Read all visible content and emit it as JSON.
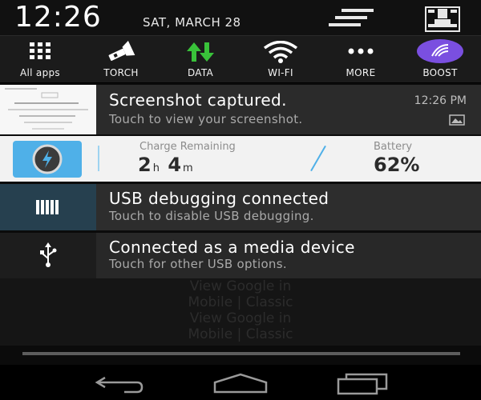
{
  "status_bar": {
    "time": "12:26",
    "date": "SAT, MARCH 28"
  },
  "quick_settings": [
    {
      "label": "All apps",
      "icon": "grid-icon"
    },
    {
      "label": "TORCH",
      "icon": "flashlight-icon"
    },
    {
      "label": "DATA",
      "icon": "data-arrows-icon"
    },
    {
      "label": "WI-FI",
      "icon": "wifi-icon"
    },
    {
      "label": "MORE",
      "icon": "more-dots-icon"
    },
    {
      "label": "BOOST",
      "icon": "boost-icon"
    }
  ],
  "notifications": {
    "screenshot": {
      "title": "Screenshot captured.",
      "subtitle": "Touch to view your screenshot.",
      "time": "12:26 PM"
    },
    "battery": {
      "charge_label": "Charge Remaining",
      "hours": "2",
      "hours_unit": "h",
      "minutes": "4",
      "minutes_unit": "m",
      "battery_label": "Battery",
      "battery_value": "62%"
    },
    "usb_debugging": {
      "title": "USB debugging connected",
      "subtitle": "Touch to disable USB debugging."
    },
    "media_device": {
      "title": "Connected as a media device",
      "subtitle": "Touch for other USB options."
    }
  },
  "background_text": [
    "View Google in",
    "Mobile | Classic",
    "View Google in",
    "Mobile | Classic"
  ],
  "colors": {
    "accent": "#4fb0e8",
    "data_green": "#39c23a",
    "boost_purple": "#7a4fe0"
  }
}
